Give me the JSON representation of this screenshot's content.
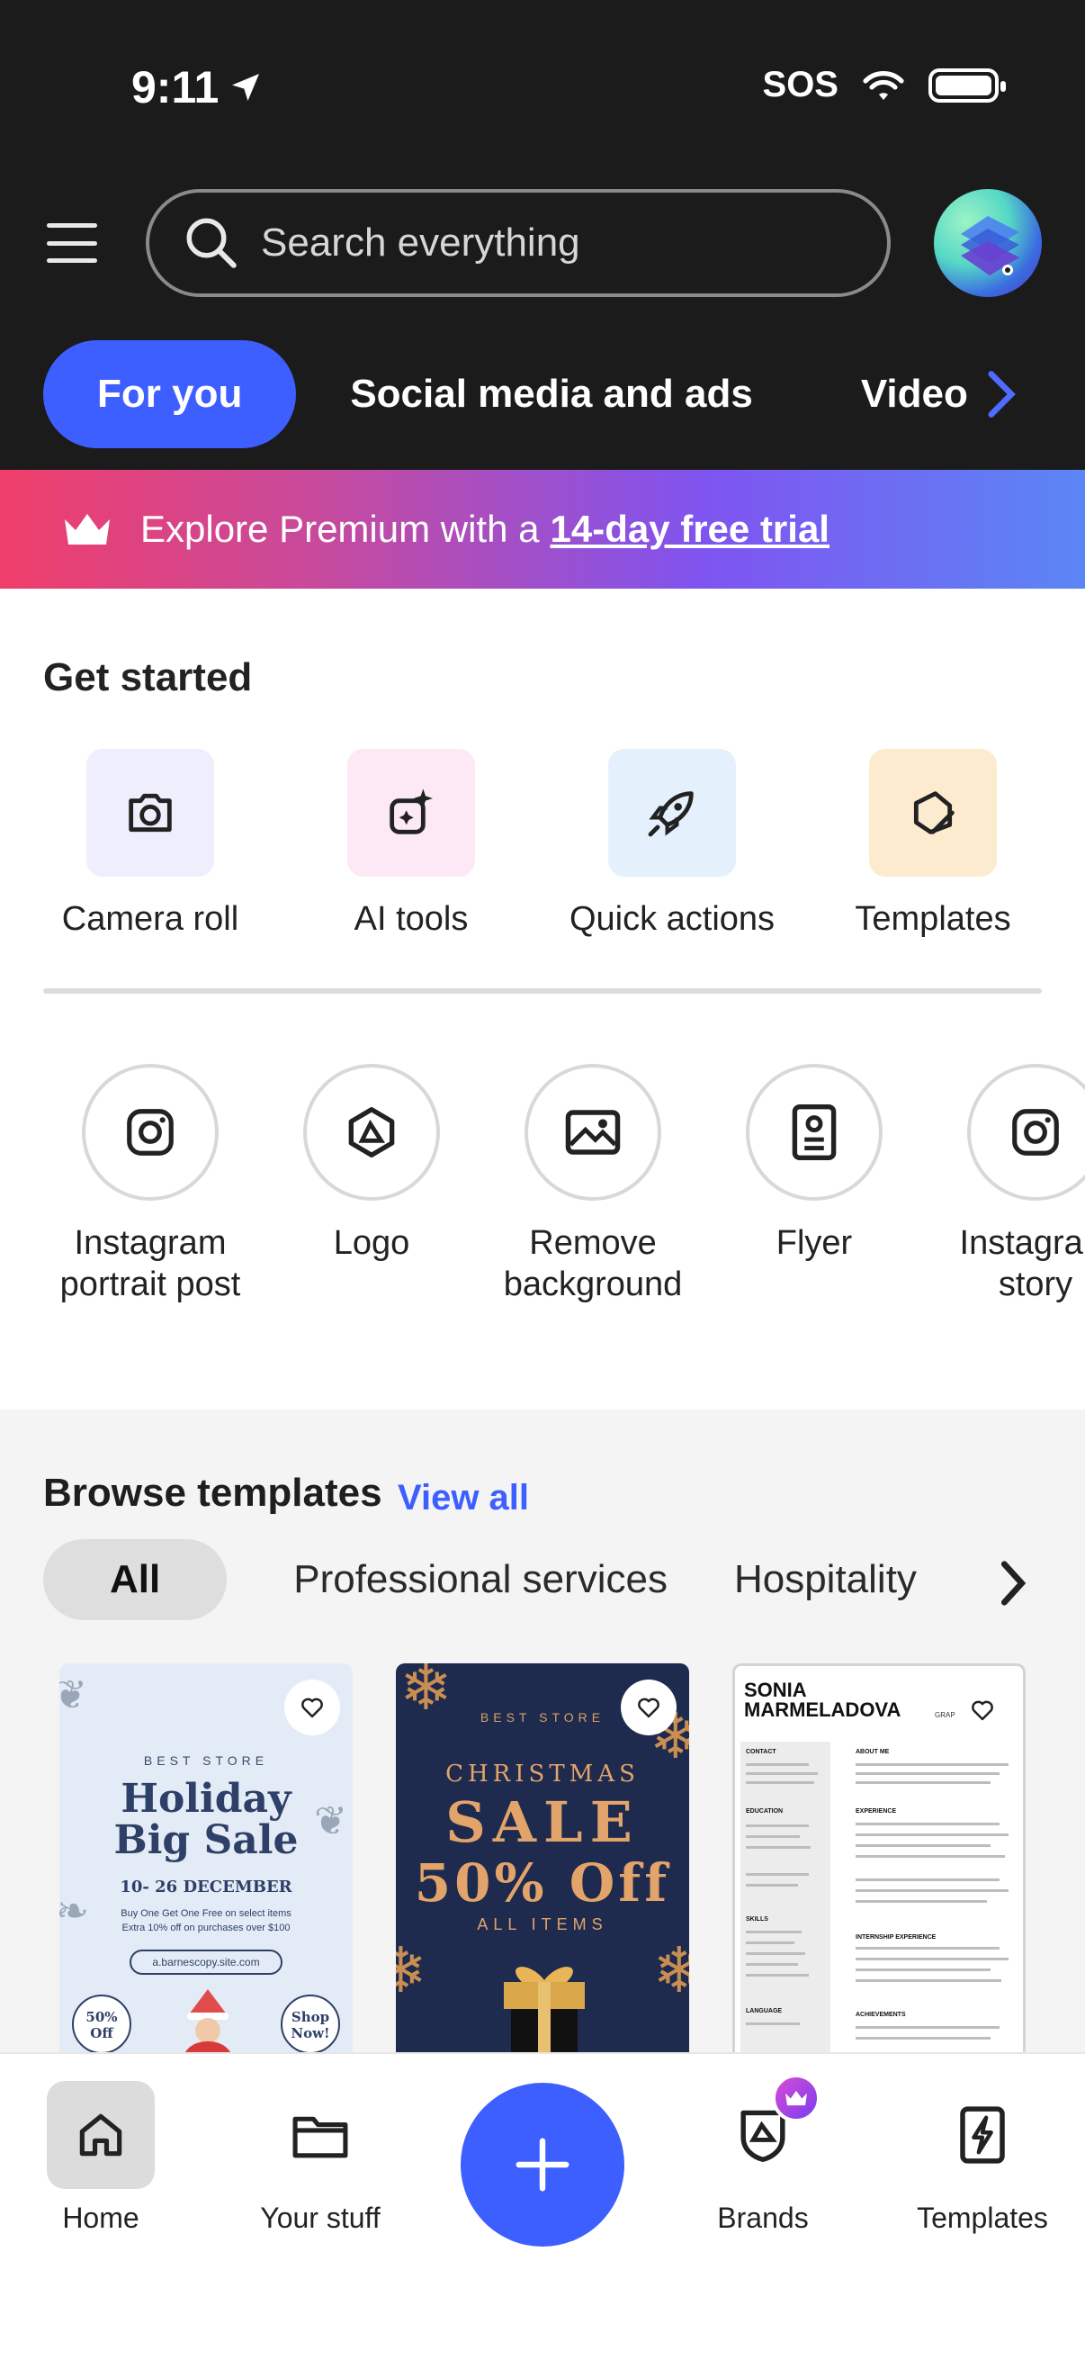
{
  "status_bar": {
    "time": "9:11",
    "carrier": "SOS"
  },
  "header": {
    "search_placeholder": "Search everything",
    "tabs": [
      {
        "label": "For you",
        "active": true
      },
      {
        "label": "Social media and ads",
        "active": false
      },
      {
        "label": "Video",
        "active": false
      }
    ]
  },
  "promo": {
    "text": "Explore Premium with a",
    "link": "14-day free trial",
    "colors": [
      "#f03e6a",
      "#7f54f0",
      "#5b86f5"
    ]
  },
  "get_started": {
    "title": "Get started",
    "items": [
      {
        "label": "Camera roll",
        "icon": "camera-icon",
        "bg": "#eeeefc"
      },
      {
        "label": "AI tools",
        "icon": "sparkle-edit-icon",
        "bg": "#fde8f6"
      },
      {
        "label": "Quick actions",
        "icon": "rocket-icon",
        "bg": "#e4f1fd"
      },
      {
        "label": "Templates",
        "icon": "templates-icon",
        "bg": "#fdebd0"
      }
    ]
  },
  "quick_create": [
    {
      "label": "Instagram\nportrait post",
      "icon": "instagram-icon"
    },
    {
      "label": "Logo",
      "icon": "logo-icon"
    },
    {
      "label": "Remove\nbackground",
      "icon": "image-icon"
    },
    {
      "label": "Flyer",
      "icon": "flyer-icon"
    },
    {
      "label": "Instagram\nstory",
      "icon": "instagram-icon"
    }
  ],
  "browse_templates": {
    "title": "Browse templates",
    "view_all": "View all",
    "chips": [
      {
        "label": "All",
        "active": true
      },
      {
        "label": "Professional services",
        "active": false
      },
      {
        "label": "Hospitality",
        "active": false
      }
    ],
    "cards": [
      {
        "store": "BEST STORE",
        "title_line1": "Holiday",
        "title_line2": "Big Sale",
        "dates": "10- 26 DECEMBER",
        "line1": "Buy One Get One Free on select items",
        "line2": "Extra 10% off on purchases over $100",
        "url": "a.barnescopy.site.com",
        "badge_left": "50% Off",
        "badge_right": "Shop Now!"
      },
      {
        "store": "BEST STORE",
        "line1": "CHRISTMAS",
        "line2": "SALE",
        "line3": "50% Off",
        "line4": "ALL ITEMS"
      },
      {
        "name_line1": "SONIA",
        "name_line2": "MARMELADOVA",
        "role": "GRAPHIC",
        "sections": [
          "CONTACT",
          "ABOUT ME",
          "EDUCATION",
          "EXPERIENCE",
          "SKILLS",
          "INTERNSHIP EXPERIENCE",
          "LANGUAGE",
          "ACHIEVEMENTS"
        ]
      }
    ]
  },
  "bottom_nav": [
    {
      "label": "Home",
      "icon": "home-icon",
      "active": true
    },
    {
      "label": "Your stuff",
      "icon": "folder-icon",
      "active": false
    },
    {
      "label": "Brands",
      "icon": "brands-icon",
      "active": false
    },
    {
      "label": "Templates",
      "icon": "templates-bolt-icon",
      "active": false
    }
  ]
}
